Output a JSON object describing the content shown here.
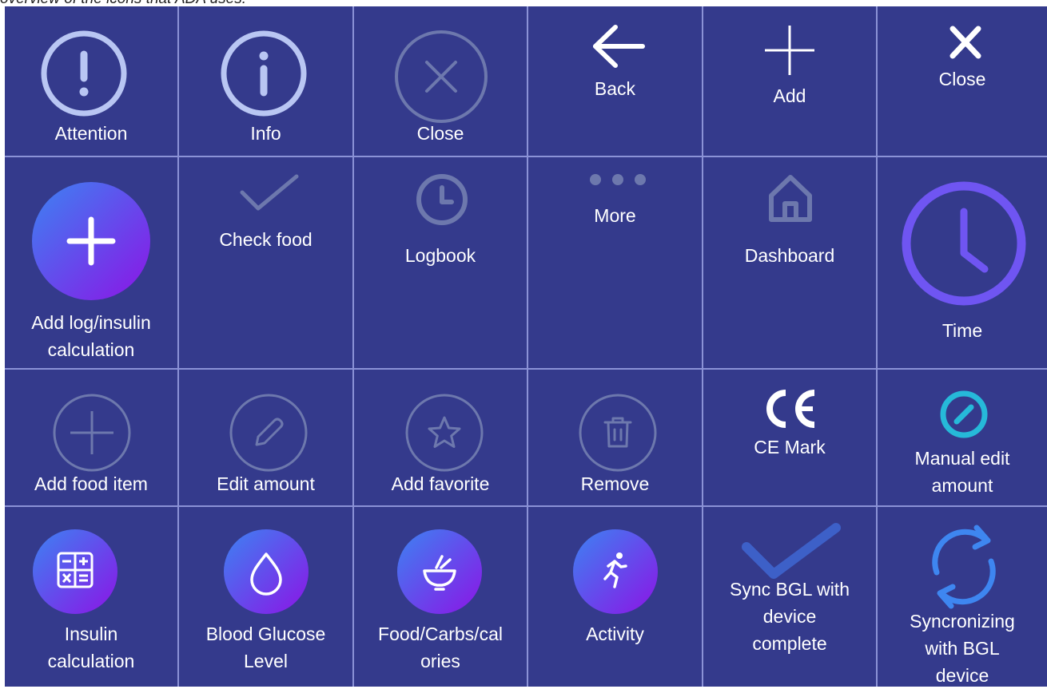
{
  "caption": "overview of the icons that ADA uses:",
  "colors": {
    "cell_background": "#343a8c",
    "grid_lines": "#8b92d6",
    "icon_light": "#b9c6f3",
    "icon_muted": "#6d78ad",
    "gradient_start": "#3c83f2",
    "gradient_end": "#8c14e6",
    "teal": "#26b9d9"
  },
  "icons": [
    [
      {
        "label": "Attention",
        "icon": "attention-icon"
      },
      {
        "label": "Info",
        "icon": "info-icon"
      },
      {
        "label": "Close",
        "icon": "close-circle-icon"
      },
      {
        "label": "Back",
        "icon": "back-arrow-icon"
      },
      {
        "label": "Add",
        "icon": "plus-icon"
      },
      {
        "label": "Close",
        "icon": "close-x-icon"
      }
    ],
    [
      {
        "label": "Add log/insulin\ncalculation",
        "icon": "add-log-icon"
      },
      {
        "label": "Check food",
        "icon": "check-icon"
      },
      {
        "label": "Logbook",
        "icon": "clock-icon"
      },
      {
        "label": "More",
        "icon": "more-dots-icon"
      },
      {
        "label": "Dashboard",
        "icon": "home-icon"
      },
      {
        "label": "Time",
        "icon": "time-icon"
      }
    ],
    [
      {
        "label": "Add food item",
        "icon": "add-food-circle-icon"
      },
      {
        "label": "Edit amount",
        "icon": "pencil-circle-icon"
      },
      {
        "label": "Add favorite",
        "icon": "star-circle-icon"
      },
      {
        "label": "Remove",
        "icon": "trash-circle-icon"
      },
      {
        "label": "CE Mark",
        "icon": "ce-mark-icon"
      },
      {
        "label": "Manual edit\namount",
        "icon": "teal-edit-icon"
      }
    ],
    [
      {
        "label": "Insulin\ncalculation",
        "icon": "calculator-icon"
      },
      {
        "label": "Blood Glucose\nLevel",
        "icon": "drop-icon"
      },
      {
        "label": "Food/Carbs/cal\nories",
        "icon": "bowl-icon"
      },
      {
        "label": "Activity",
        "icon": "running-icon"
      },
      {
        "label": "Sync BGL with\ndevice\ncomplete",
        "icon": "sync-check-icon"
      },
      {
        "label": "Syncronizing\nwith BGL\ndevice",
        "icon": "sync-arrows-icon"
      }
    ]
  ]
}
